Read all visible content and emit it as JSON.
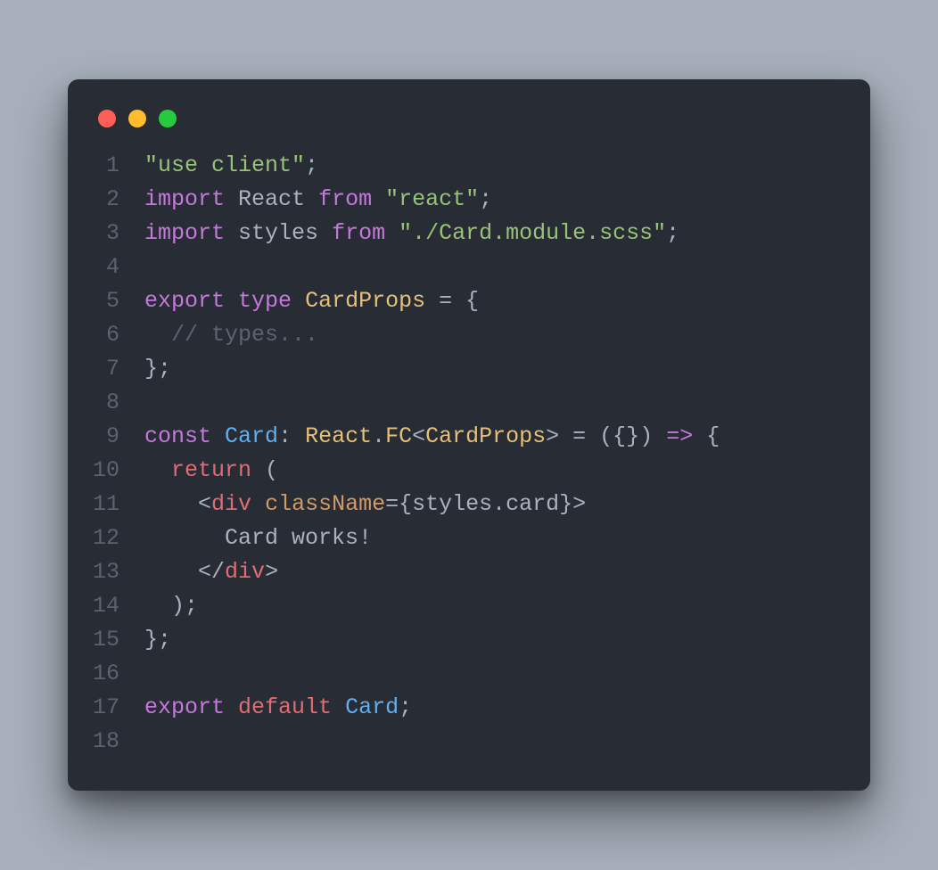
{
  "traffic_lights": {
    "close": "#ff5f56",
    "minimize": "#ffbd2e",
    "zoom": "#27c93f"
  },
  "lines": [
    {
      "n": 1,
      "tokens": [
        {
          "cls": "tok-string",
          "t": "\"use client\""
        },
        {
          "cls": "tok-punct",
          "t": ";"
        }
      ]
    },
    {
      "n": 2,
      "tokens": [
        {
          "cls": "tok-keyword",
          "t": "import"
        },
        {
          "cls": "tok-default",
          "t": " React "
        },
        {
          "cls": "tok-keyword",
          "t": "from"
        },
        {
          "cls": "tok-default",
          "t": " "
        },
        {
          "cls": "tok-string",
          "t": "\"react\""
        },
        {
          "cls": "tok-punct",
          "t": ";"
        }
      ]
    },
    {
      "n": 3,
      "tokens": [
        {
          "cls": "tok-keyword",
          "t": "import"
        },
        {
          "cls": "tok-default",
          "t": " styles "
        },
        {
          "cls": "tok-keyword",
          "t": "from"
        },
        {
          "cls": "tok-default",
          "t": " "
        },
        {
          "cls": "tok-string",
          "t": "\"./Card.module.scss\""
        },
        {
          "cls": "tok-punct",
          "t": ";"
        }
      ]
    },
    {
      "n": 4,
      "tokens": [
        {
          "cls": "tok-default",
          "t": ""
        }
      ]
    },
    {
      "n": 5,
      "tokens": [
        {
          "cls": "tok-keyword",
          "t": "export"
        },
        {
          "cls": "tok-default",
          "t": " "
        },
        {
          "cls": "tok-keyword",
          "t": "type"
        },
        {
          "cls": "tok-default",
          "t": " "
        },
        {
          "cls": "tok-type",
          "t": "CardProps"
        },
        {
          "cls": "tok-default",
          "t": " = {"
        }
      ]
    },
    {
      "n": 6,
      "tokens": [
        {
          "cls": "tok-default",
          "t": "  "
        },
        {
          "cls": "tok-comment",
          "t": "// types..."
        }
      ]
    },
    {
      "n": 7,
      "tokens": [
        {
          "cls": "tok-default",
          "t": "};"
        }
      ]
    },
    {
      "n": 8,
      "tokens": [
        {
          "cls": "tok-default",
          "t": ""
        }
      ]
    },
    {
      "n": 9,
      "tokens": [
        {
          "cls": "tok-keyword",
          "t": "const"
        },
        {
          "cls": "tok-default",
          "t": " "
        },
        {
          "cls": "tok-ident",
          "t": "Card"
        },
        {
          "cls": "tok-default",
          "t": ": "
        },
        {
          "cls": "tok-type",
          "t": "React"
        },
        {
          "cls": "tok-default",
          "t": "."
        },
        {
          "cls": "tok-type",
          "t": "FC"
        },
        {
          "cls": "tok-default",
          "t": "<"
        },
        {
          "cls": "tok-type",
          "t": "CardProps"
        },
        {
          "cls": "tok-default",
          "t": "> = ({}) "
        },
        {
          "cls": "tok-keyword",
          "t": "=>"
        },
        {
          "cls": "tok-default",
          "t": " {"
        }
      ]
    },
    {
      "n": 10,
      "tokens": [
        {
          "cls": "tok-default",
          "t": "  "
        },
        {
          "cls": "tok-keyword2",
          "t": "return"
        },
        {
          "cls": "tok-default",
          "t": " ("
        }
      ]
    },
    {
      "n": 11,
      "tokens": [
        {
          "cls": "tok-default",
          "t": "    "
        },
        {
          "cls": "tok-punct",
          "t": "<"
        },
        {
          "cls": "tok-tag",
          "t": "div"
        },
        {
          "cls": "tok-default",
          "t": " "
        },
        {
          "cls": "tok-attr",
          "t": "className"
        },
        {
          "cls": "tok-default",
          "t": "={styles.card}"
        },
        {
          "cls": "tok-punct",
          "t": ">"
        }
      ]
    },
    {
      "n": 12,
      "tokens": [
        {
          "cls": "tok-default",
          "t": "      Card works!"
        }
      ]
    },
    {
      "n": 13,
      "tokens": [
        {
          "cls": "tok-default",
          "t": "    "
        },
        {
          "cls": "tok-punct",
          "t": "</"
        },
        {
          "cls": "tok-tag",
          "t": "div"
        },
        {
          "cls": "tok-punct",
          "t": ">"
        }
      ]
    },
    {
      "n": 14,
      "tokens": [
        {
          "cls": "tok-default",
          "t": "  );"
        }
      ]
    },
    {
      "n": 15,
      "tokens": [
        {
          "cls": "tok-default",
          "t": "};"
        }
      ]
    },
    {
      "n": 16,
      "tokens": [
        {
          "cls": "tok-default",
          "t": ""
        }
      ]
    },
    {
      "n": 17,
      "tokens": [
        {
          "cls": "tok-keyword",
          "t": "export"
        },
        {
          "cls": "tok-default",
          "t": " "
        },
        {
          "cls": "tok-keyword2",
          "t": "default"
        },
        {
          "cls": "tok-default",
          "t": " "
        },
        {
          "cls": "tok-ident",
          "t": "Card"
        },
        {
          "cls": "tok-punct",
          "t": ";"
        }
      ]
    },
    {
      "n": 18,
      "tokens": [
        {
          "cls": "tok-default",
          "t": ""
        }
      ]
    }
  ]
}
